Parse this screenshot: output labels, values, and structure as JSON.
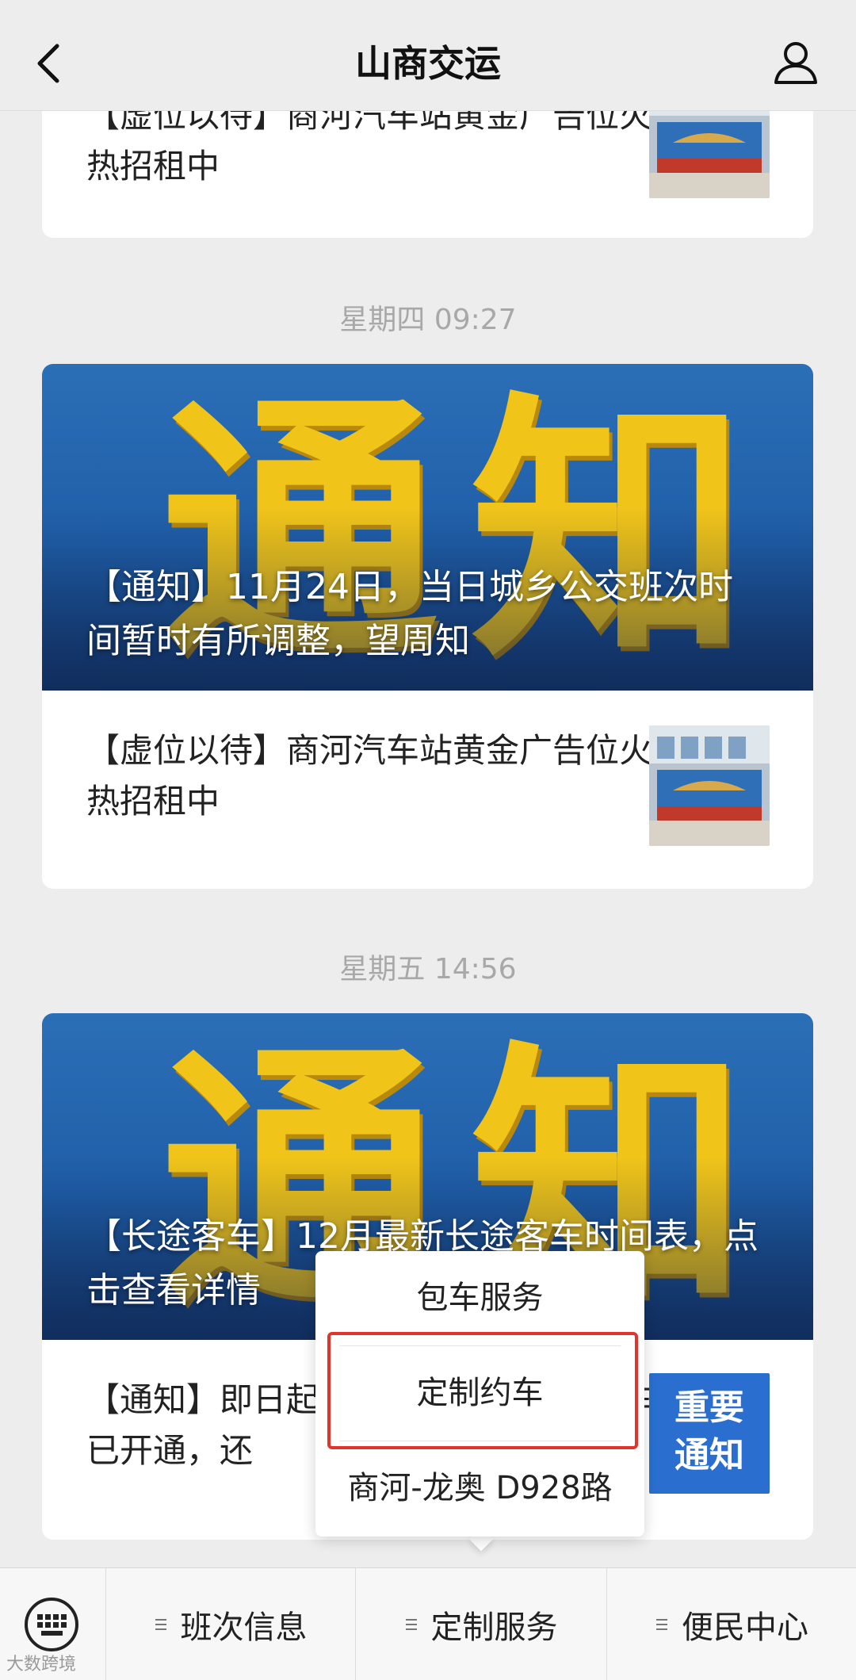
{
  "header": {
    "title": "山商交运"
  },
  "feed": {
    "top_item": {
      "text": "【虚位以待】商河汽车站黄金广告位火热招租中"
    },
    "groups": [
      {
        "timestamp": "星期四 09:27",
        "banner": {
          "decorative_text": "通知",
          "caption": "【通知】11月24日，当日城乡公交班次时间暂时有所调整，望周知"
        },
        "item": {
          "text": "【虚位以待】商河汽车站黄金广告位火热招租中"
        }
      },
      {
        "timestamp": "星期五 14:56",
        "banner": {
          "decorative_text": "通知",
          "caption": "【长途客车】12月最新长途客车时间表，点击查看详情"
        },
        "item": {
          "text": "【通知】即日起，商河-龙奥D928路车已开通，还",
          "thumb_text_1": "重要",
          "thumb_text_2": "通知"
        }
      }
    ]
  },
  "popup_menu": {
    "items": [
      "包车服务",
      "定制约车",
      "商河-龙奥 D928路"
    ],
    "highlighted_index": 1,
    "highlight_color": "#e0342c"
  },
  "bottom_menu": {
    "items": [
      "班次信息",
      "定制服务",
      "便民中心"
    ]
  },
  "watermark": "大数跨境",
  "colors": {
    "background": "#ededed",
    "banner_blue": "#1f5ea8",
    "banner_gold": "#f0c419"
  }
}
